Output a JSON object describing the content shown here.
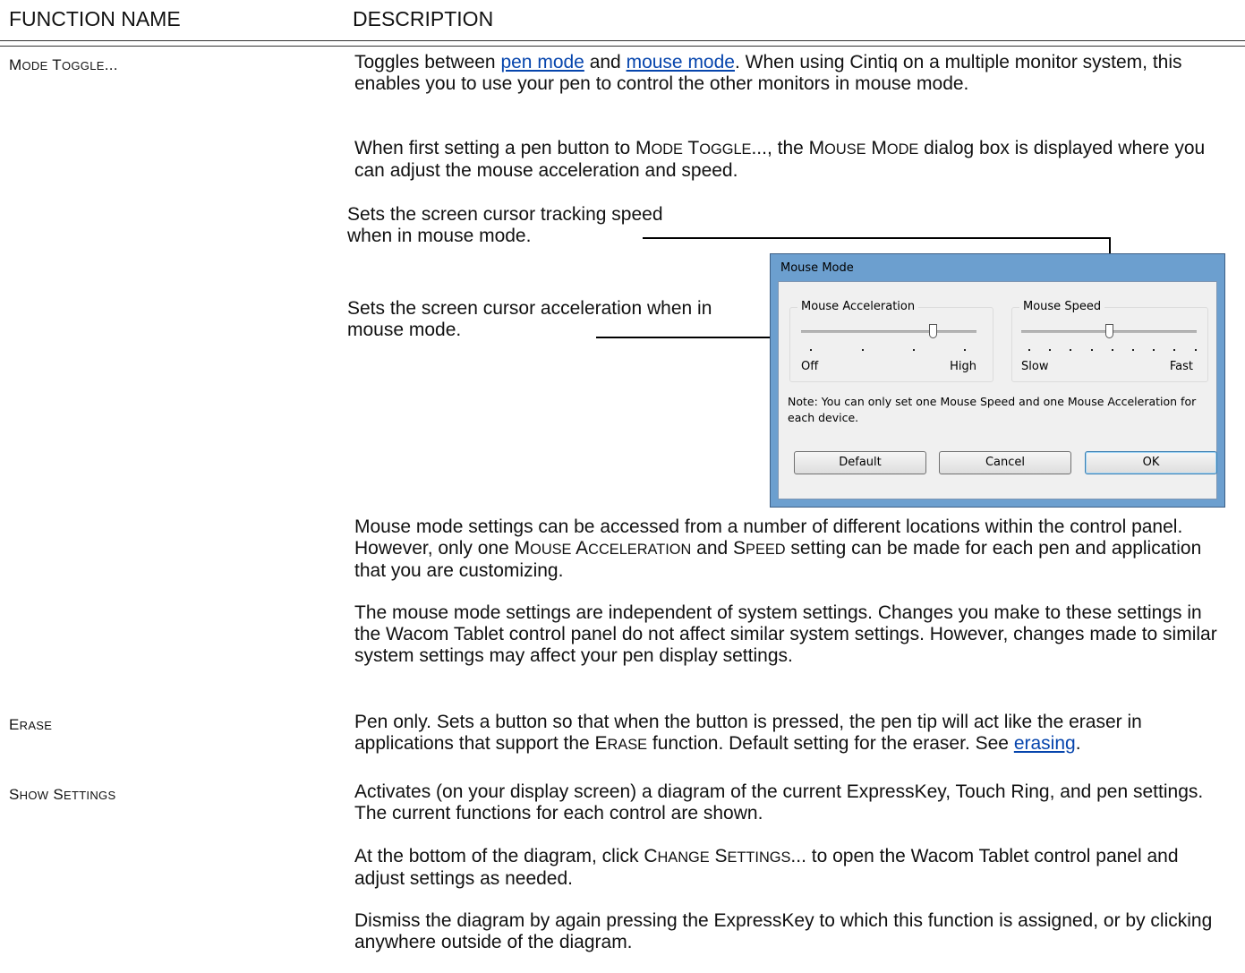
{
  "header": {
    "col1": "FUNCTION NAME",
    "col2": "DESCRIPTION"
  },
  "mode_toggle": {
    "name_first": "M",
    "name_first_sc": "ODE",
    "name_second": " T",
    "name_second_sc": "OGGLE",
    "name_dots": "...",
    "p1_a": "Toggles between ",
    "p1_link1": "pen mode",
    "p1_b": " and ",
    "p1_link2": "mouse mode",
    "p1_c": ".  When using Cintiq on a multiple monitor system, this enables you to use your pen to control the other monitors in mouse mode.",
    "p2_a": "When first setting a pen button to M",
    "p2_sc1": "ODE",
    "p2_b": " T",
    "p2_sc2": "OGGLE",
    "p2_c": "..., the M",
    "p2_sc3": "OUSE",
    "p2_d": " M",
    "p2_sc4": "ODE",
    "p2_e": " dialog box is displayed where you can adjust the mouse acceleration and speed.",
    "callout_speed": "Sets the screen cursor tracking speed when in mouse mode.",
    "callout_accel": "Sets the screen cursor acceleration when in mouse mode.",
    "p3_a": "Mouse mode settings can be accessed from a number of different locations within the control panel.  However, only one M",
    "p3_sc1": "OUSE",
    "p3_b": " A",
    "p3_sc2": "CCELERATION",
    "p3_c": " and S",
    "p3_sc3": "PEED",
    "p3_d": " setting can be made for each pen and application that you are customizing.",
    "p4": "The mouse mode settings are independent of system settings.  Changes you make to these settings in the Wacom Tablet control panel do not affect similar system settings.  However, changes made to similar system settings may affect your pen display settings."
  },
  "dialog": {
    "title": "Mouse Mode",
    "accel_group": "Mouse Acceleration",
    "accel_min": "Off",
    "accel_max": "High",
    "accel_value_fraction": 0.75,
    "speed_group": "Mouse Speed",
    "speed_min": "Slow",
    "speed_max": "Fast",
    "speed_value_fraction": 0.5,
    "note": "Note: You can only set one Mouse Speed and one Mouse Acceleration for each device.",
    "btn_default": "Default",
    "btn_cancel": "Cancel",
    "btn_ok": "OK"
  },
  "erase": {
    "name_first": "E",
    "name_sc": "RASE",
    "p_a": "Pen only.  Sets a button so that when the button is pressed, the pen tip will act like the eraser in applications that support the E",
    "p_sc": "RASE",
    "p_b": " function.  Default setting for the eraser.  See ",
    "p_link": "erasing",
    "p_c": "."
  },
  "show_settings": {
    "name_first": "S",
    "name_sc1": "HOW",
    "name_second": " S",
    "name_sc2": "ETTINGS",
    "p1": "Activates (on your display screen) a diagram of the current ExpressKey, Touch Ring, and pen settings.  The current functions for each control are shown.",
    "p2_a": "At the bottom of the diagram, click C",
    "p2_sc1": "HANGE",
    "p2_b": " S",
    "p2_sc2": "ETTINGS",
    "p2_c": "... to open the Wacom Tablet control panel and adjust settings as needed.",
    "p3": "Dismiss the diagram by again pressing the ExpressKey to which this function is assigned, or by clicking anywhere outside of the diagram."
  }
}
